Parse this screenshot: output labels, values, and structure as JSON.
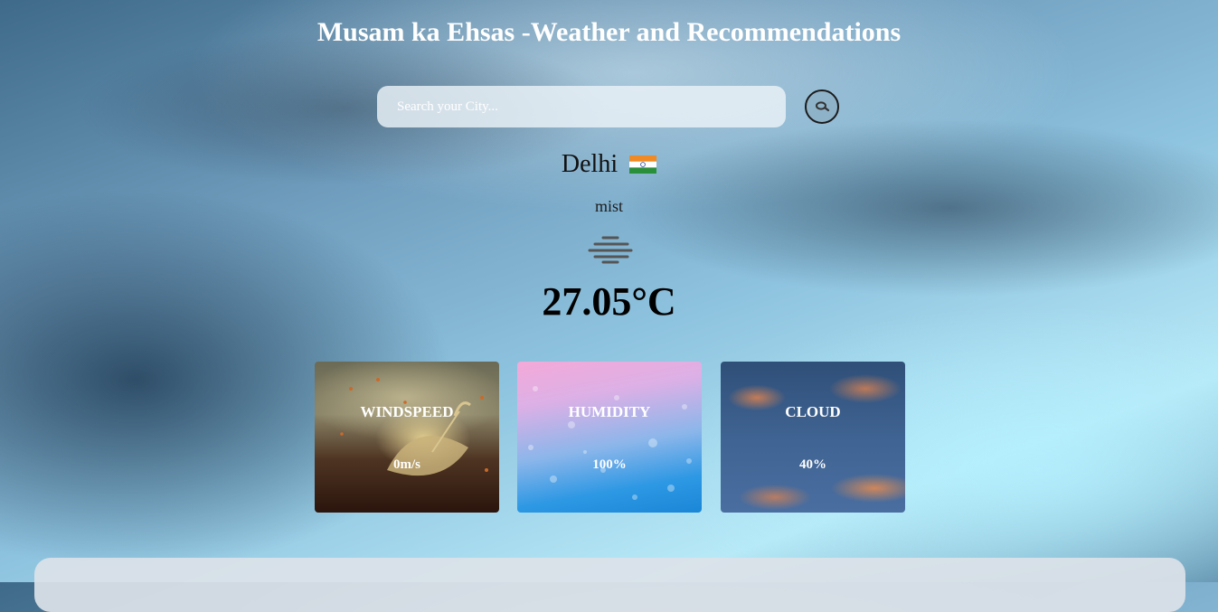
{
  "header": {
    "title": "Musam ka Ehsas -Weather and Recommendations"
  },
  "search": {
    "placeholder": "Search your City...",
    "value": ""
  },
  "weather": {
    "city": "Delhi",
    "country_flag": "🇮🇳",
    "description": "mist",
    "icon": "mist-icon",
    "temperature": "27.05°C"
  },
  "cards": [
    {
      "label": "WINDSPEED",
      "value": "0m/s"
    },
    {
      "label": "HUMIDITY",
      "value": "100%"
    },
    {
      "label": "CLOUD",
      "value": "40%"
    }
  ]
}
